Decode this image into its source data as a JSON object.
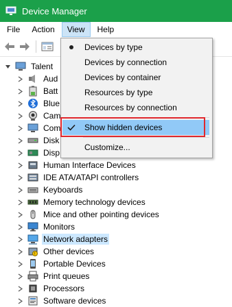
{
  "window": {
    "title": "Device Manager"
  },
  "menu": {
    "file": "File",
    "action": "Action",
    "view": "View",
    "help": "Help"
  },
  "view_menu": {
    "items": [
      {
        "label": "Devices by type",
        "mark": "bullet"
      },
      {
        "label": "Devices by connection",
        "mark": ""
      },
      {
        "label": "Devices by container",
        "mark": ""
      },
      {
        "label": "Resources by type",
        "mark": ""
      },
      {
        "label": "Resources by connection",
        "mark": ""
      },
      {
        "label": "Show hidden devices",
        "mark": "check"
      },
      {
        "label": "Customize...",
        "mark": ""
      }
    ]
  },
  "tree": {
    "root": "Talent",
    "items": [
      {
        "label": "Aud",
        "icon": "speaker-icon"
      },
      {
        "label": "Batt",
        "icon": "battery-icon"
      },
      {
        "label": "Blue",
        "icon": "bluetooth-icon"
      },
      {
        "label": "Cam",
        "icon": "camera-icon"
      },
      {
        "label": "Com",
        "icon": "computer-icon"
      },
      {
        "label": "Disk",
        "icon": "disk-drive-icon"
      },
      {
        "label": "Disp",
        "icon": "display-adapter-icon"
      },
      {
        "label": "Human Interface Devices",
        "icon": "hid-icon"
      },
      {
        "label": "IDE ATA/ATAPI controllers",
        "icon": "ide-controller-icon"
      },
      {
        "label": "Keyboards",
        "icon": "keyboard-icon"
      },
      {
        "label": "Memory technology devices",
        "icon": "memory-icon"
      },
      {
        "label": "Mice and other pointing devices",
        "icon": "mouse-icon"
      },
      {
        "label": "Monitors",
        "icon": "monitor-icon"
      },
      {
        "label": "Network adapters",
        "icon": "network-adapter-icon"
      },
      {
        "label": "Other devices",
        "icon": "other-devices-icon"
      },
      {
        "label": "Portable Devices",
        "icon": "portable-devices-icon"
      },
      {
        "label": "Print queues",
        "icon": "printer-icon"
      },
      {
        "label": "Processors",
        "icon": "processor-icon"
      },
      {
        "label": "Software devices",
        "icon": "software-devices-icon"
      }
    ]
  },
  "colors": {
    "titlebar": "#1ba04a",
    "menu_highlight": "#91c9f7",
    "annotation_red": "#e0262c",
    "selection": "#cce8ff"
  }
}
